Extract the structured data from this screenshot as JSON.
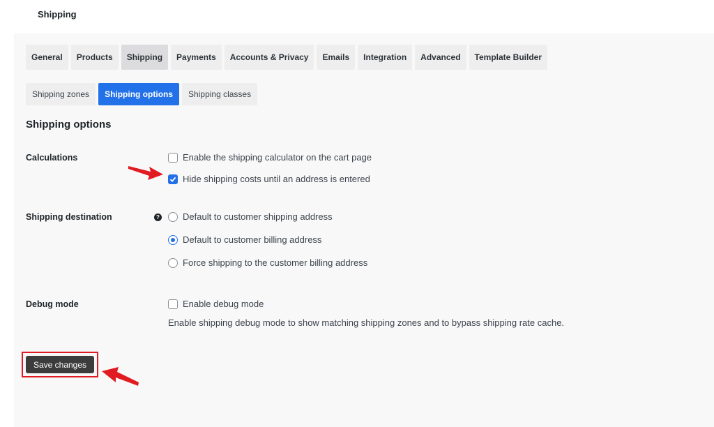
{
  "page_title": "Shipping",
  "main_tabs": [
    "General",
    "Products",
    "Shipping",
    "Payments",
    "Accounts & Privacy",
    "Emails",
    "Integration",
    "Advanced",
    "Template Builder"
  ],
  "sub_tabs": [
    "Shipping zones",
    "Shipping options",
    "Shipping classes"
  ],
  "section_title": "Shipping options",
  "calculations": {
    "label": "Calculations",
    "options": [
      {
        "label": "Enable the shipping calculator on the cart page",
        "checked": false
      },
      {
        "label": "Hide shipping costs until an address is entered",
        "checked": true
      }
    ]
  },
  "destination": {
    "label": "Shipping destination",
    "help": "?",
    "options": [
      {
        "label": "Default to customer shipping address",
        "selected": false
      },
      {
        "label": "Default to customer billing address",
        "selected": true
      },
      {
        "label": "Force shipping to the customer billing address",
        "selected": false
      }
    ]
  },
  "debug": {
    "label": "Debug mode",
    "option_label": "Enable debug mode",
    "checked": false,
    "description": "Enable shipping debug mode to show matching shipping zones and to bypass shipping rate cache."
  },
  "save_label": "Save changes",
  "colors": {
    "accent": "#2271e8",
    "annotation": "#e01b22",
    "button": "#3c3c3c"
  }
}
